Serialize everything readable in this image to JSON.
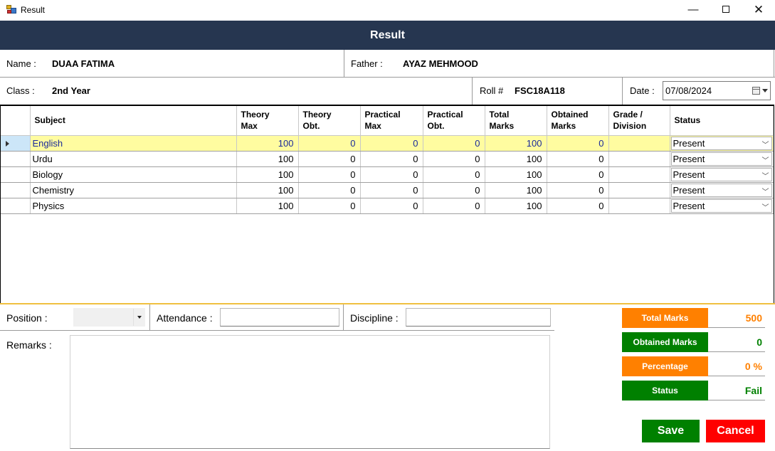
{
  "window": {
    "title": "Result",
    "minimize": "—",
    "close": "✕"
  },
  "header": {
    "title": "Result"
  },
  "student": {
    "name_label": "Name :",
    "name": "DUAA FATIMA",
    "father_label": "Father :",
    "father": "AYAZ MEHMOOD",
    "class_label": "Class :",
    "class": "2nd Year",
    "roll_label": "Roll #",
    "roll": "FSC18A118",
    "date_label": "Date :",
    "date": "07/08/2024"
  },
  "grid": {
    "columns": [
      {
        "l1": "Subject",
        "l2": ""
      },
      {
        "l1": "Theory",
        "l2": "Max"
      },
      {
        "l1": "Theory",
        "l2": "Obt."
      },
      {
        "l1": "Practical",
        "l2": "Max"
      },
      {
        "l1": "Practical",
        "l2": "Obt."
      },
      {
        "l1": "Total",
        "l2": "Marks"
      },
      {
        "l1": "Obtained",
        "l2": "Marks"
      },
      {
        "l1": "Grade /",
        "l2": "Division"
      },
      {
        "l1": "Status",
        "l2": ""
      }
    ],
    "rows": [
      {
        "subject": "English",
        "theory_max": "100",
        "theory_obt": "0",
        "practical_max": "0",
        "practical_obt": "0",
        "total": "100",
        "obtained": "0",
        "grade": "",
        "status": "Present"
      },
      {
        "subject": "Urdu",
        "theory_max": "100",
        "theory_obt": "0",
        "practical_max": "0",
        "practical_obt": "0",
        "total": "100",
        "obtained": "0",
        "grade": "",
        "status": "Present"
      },
      {
        "subject": "Biology",
        "theory_max": "100",
        "theory_obt": "0",
        "practical_max": "0",
        "practical_obt": "0",
        "total": "100",
        "obtained": "0",
        "grade": "",
        "status": "Present"
      },
      {
        "subject": "Chemistry",
        "theory_max": "100",
        "theory_obt": "0",
        "practical_max": "0",
        "practical_obt": "0",
        "total": "100",
        "obtained": "0",
        "grade": "",
        "status": "Present"
      },
      {
        "subject": "Physics",
        "theory_max": "100",
        "theory_obt": "0",
        "practical_max": "0",
        "practical_obt": "0",
        "total": "100",
        "obtained": "0",
        "grade": "",
        "status": "Present"
      }
    ]
  },
  "form": {
    "position_label": "Position :",
    "position_value": "",
    "attendance_label": "Attendance :",
    "attendance_value": "",
    "discipline_label": "Discipline :",
    "discipline_value": "",
    "remarks_label": "Remarks :",
    "remarks_value": ""
  },
  "summary": {
    "total_label": "Total Marks",
    "total_value": "500",
    "obtained_label": "Obtained Marks",
    "obtained_value": "0",
    "percentage_label": "Percentage",
    "percentage_value": "0 %",
    "status_label": "Status",
    "status_value": "Fail"
  },
  "buttons": {
    "save": "Save",
    "cancel": "Cancel"
  },
  "colors": {
    "header": "#263650",
    "orange": "#ff8000",
    "green": "#008000",
    "save": "#008000",
    "cancel": "#ff0000",
    "selected_row": "#fffca0"
  }
}
